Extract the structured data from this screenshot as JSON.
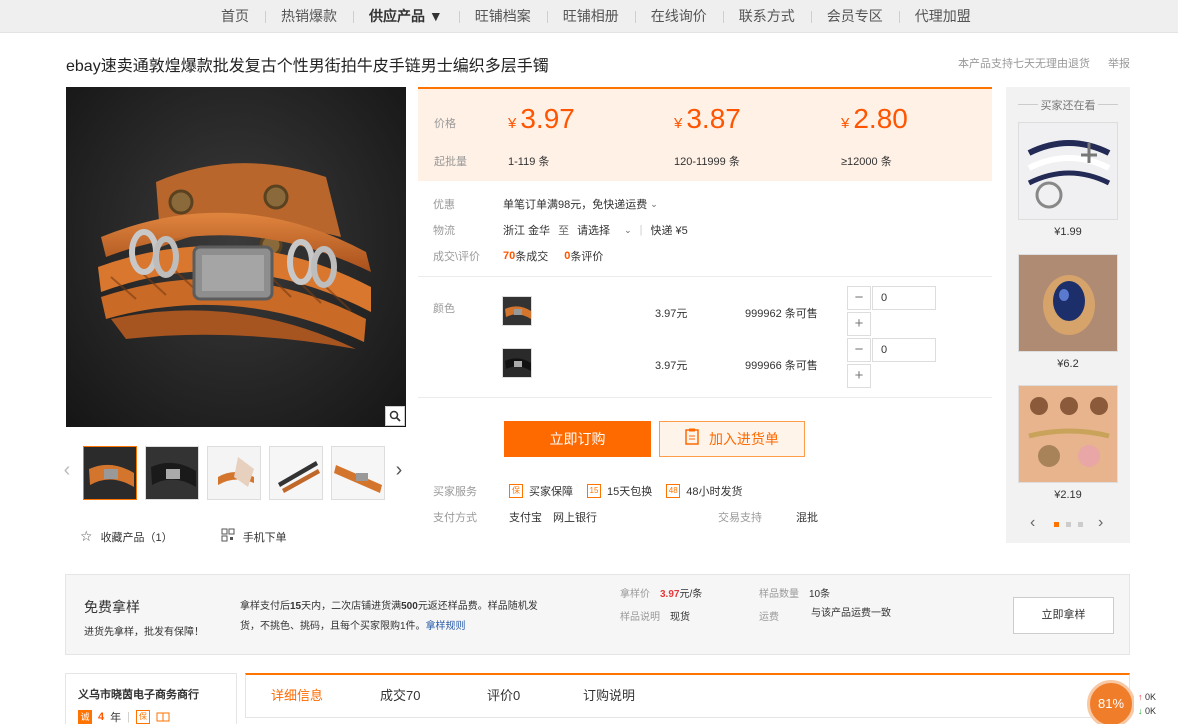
{
  "nav": [
    "首页",
    "热销爆款",
    "供应产品 ▼",
    "旺铺档案",
    "旺铺相册",
    "在线询价",
    "联系方式",
    "会员专区",
    "代理加盟"
  ],
  "product": {
    "title": "ebay速卖通敦煌爆款批发复古个性男街拍牛皮手链男士编织多层手镯",
    "support_note": "本产品支持七天无理由退货",
    "report": "举报"
  },
  "pricing": {
    "price_label": "价格",
    "moq_label": "起批量",
    "currency": "¥",
    "tiers": [
      {
        "price": "3.97",
        "qty": "1-119",
        "unit": "条"
      },
      {
        "price": "3.87",
        "qty": "120-11999",
        "unit": "条"
      },
      {
        "price": "2.80",
        "qty": "≥12000",
        "unit": "条"
      }
    ]
  },
  "info": {
    "promo_label": "优惠",
    "promo_text": "单笔订单满98元，免快递运费",
    "logistics_label": "物流",
    "from": "浙江 金华",
    "to_word": "至",
    "to_select": "请选择",
    "express": "快递 ¥5",
    "deals_label": "成交\\评价",
    "deals_count": "70",
    "deals_suffix": "条成交",
    "reviews_count": "0",
    "reviews_suffix": "条评价"
  },
  "sku": {
    "color_label": "颜色",
    "items": [
      {
        "price": "3.97元",
        "stock": "999962 条可售",
        "qty": "0"
      },
      {
        "price": "3.97元",
        "stock": "999966 条可售",
        "qty": "0"
      }
    ]
  },
  "actions": {
    "buy_now": "立即订购",
    "add_cart": "加入进货单"
  },
  "services": {
    "label": "买家服务",
    "items": [
      "买家保障",
      "15天包换",
      "48小时发货"
    ],
    "icons": [
      "保",
      "15",
      "48"
    ],
    "pay_label": "支付方式",
    "pay_methods": "支付宝　网上银行",
    "trade_label": "交易支持",
    "trade_value": "混批"
  },
  "gallery": {
    "favorite": "收藏产品（1）",
    "mobile": "手机下单"
  },
  "recommend": {
    "title": "买家还在看",
    "items": [
      {
        "price": "¥1.99"
      },
      {
        "price": "¥6.2"
      },
      {
        "price": "¥2.19"
      }
    ]
  },
  "sample": {
    "title": "免费拿样",
    "subtitle": "进货先拿样，批发有保障！",
    "desc_1": "拿样支付后",
    "desc_days": "15",
    "desc_2": "天内，二次店铺进货满",
    "desc_amount": "500",
    "desc_3": "元返还样品费。样品随机发货，不挑色、挑码，且每个买家限购1件。",
    "rules_link": "拿样规则",
    "price_label": "拿样价",
    "price_value": "3.97",
    "price_unit": "元/条",
    "note_label": "样品说明",
    "note_value": "现货",
    "qty_label": "样品数量",
    "qty_value": "10条",
    "ship_label": "运费",
    "ship_value": "与该产品运费一致",
    "button": "立即拿样"
  },
  "seller": {
    "name": "义乌市晓茵电子商务商行",
    "years_badge": "诚",
    "years": "4",
    "years_unit": "年",
    "badge2": "保"
  },
  "tabs": [
    "详细信息",
    "成交70",
    "评价0",
    "订购说明"
  ],
  "widget": {
    "percent": "81%",
    "up": "0K",
    "down": "0K"
  },
  "colors": {
    "accent": "#ff6a00",
    "price": "#ff5500",
    "price_bg": "#fff1e6"
  }
}
